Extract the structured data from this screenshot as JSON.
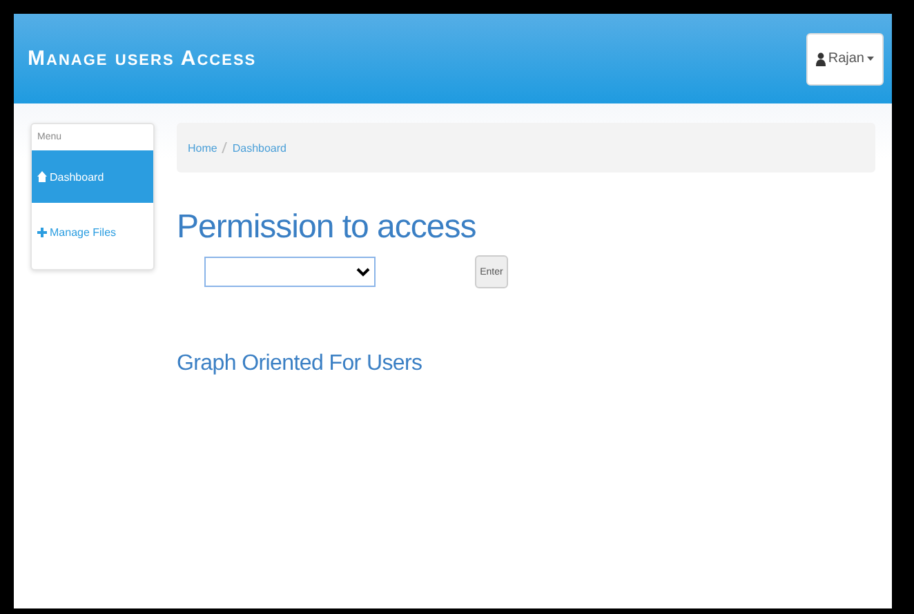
{
  "navbar": {
    "brand": "Manage users Access",
    "user_menu": "Rajan"
  },
  "sidebar": {
    "header": "Menu",
    "items": [
      {
        "label": "Dashboard",
        "selected": true
      },
      {
        "label": "Manage Files",
        "selected": false
      }
    ]
  },
  "breadcrumb": [
    "Home",
    "Dashboard"
  ],
  "heading": "Permission to access",
  "form": {
    "button": "Enter"
  },
  "subheading": "Graph Oriented For Users"
}
